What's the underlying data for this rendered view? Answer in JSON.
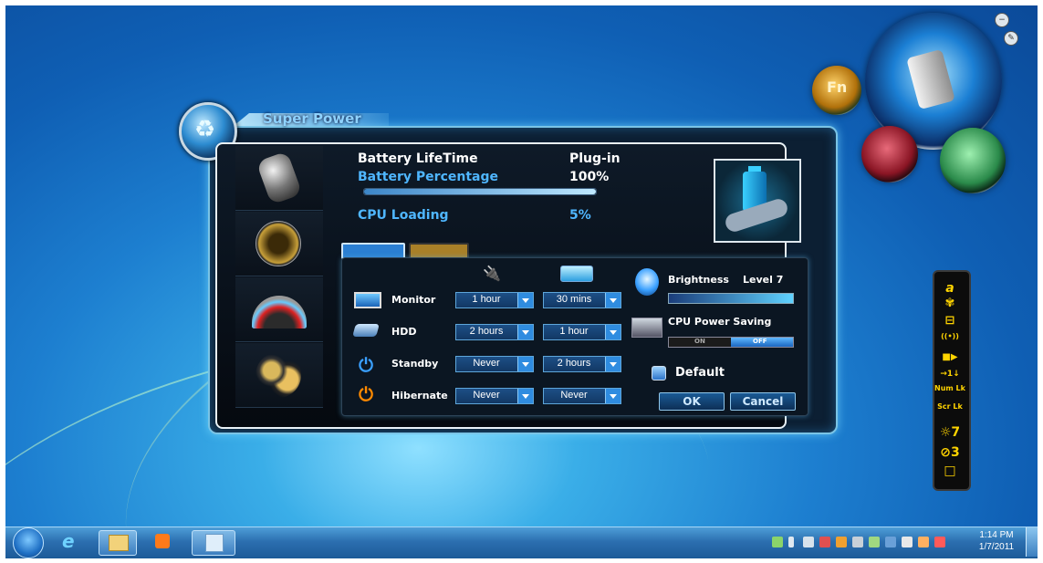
{
  "app": {
    "title": "Super Power"
  },
  "stats": {
    "battery_lifetime_label": "Battery LifeTime",
    "battery_lifetime_value": "Plug-in",
    "battery_percentage_label": "Battery Percentage",
    "battery_percentage_value": "100%",
    "battery_fill": 1.0,
    "cpu_loading_label": "CPU Loading",
    "cpu_loading_value": "5%"
  },
  "settings": {
    "rows": [
      {
        "label": "Monitor",
        "ac": "1 hour",
        "battery": "30 mins"
      },
      {
        "label": "HDD",
        "ac": "2 hours",
        "battery": "1 hour"
      },
      {
        "label": "Standby",
        "ac": "Never",
        "battery": "2 hours"
      },
      {
        "label": "Hibernate",
        "ac": "Never",
        "battery": "Never"
      }
    ],
    "brightness_label": "Brightness",
    "brightness_value": "Level 7",
    "cpu_saving_label": "CPU Power Saving",
    "toggle_on": "ON",
    "toggle_off": "OFF",
    "default_label": "Default",
    "ok_label": "OK",
    "cancel_label": "Cancel"
  },
  "orbs": {
    "fn_label": "Fn"
  },
  "toolbar": {
    "items": [
      "a",
      "✾",
      "⊟",
      "((•))",
      "■▶",
      "→1↓",
      "Num Lk",
      "Scr Lk",
      "☼7",
      "⊘3",
      "□"
    ]
  },
  "taskbar": {
    "clock_time": "1:14 PM",
    "clock_date": "1/7/2011"
  },
  "colors": {
    "accent": "#4fb6ff",
    "panel_border": "#7ac4e6",
    "toolbar_icon": "#ffd400"
  }
}
